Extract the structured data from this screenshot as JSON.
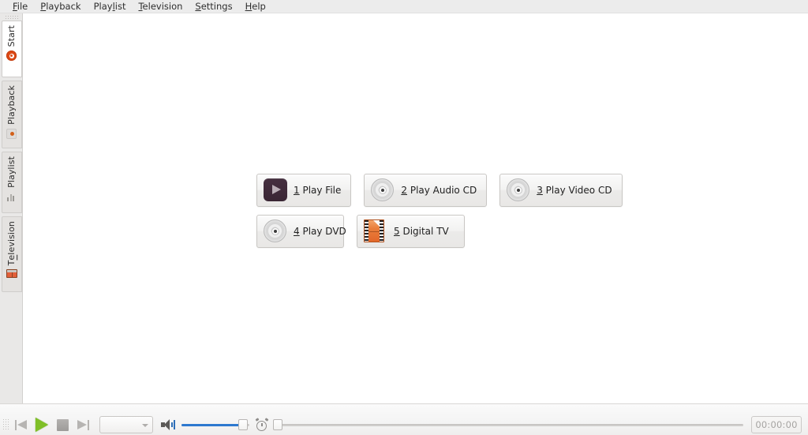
{
  "app": {
    "accent_orange": "#dd4814",
    "accent_blue": "#2d78cf",
    "play_green": "#7fbf27"
  },
  "menubar": {
    "items": [
      {
        "name": "file",
        "acc": "F",
        "rest": "ile"
      },
      {
        "name": "playback",
        "acc": "P",
        "rest": "layback"
      },
      {
        "name": "playlist",
        "pre": "Play",
        "acc": "l",
        "rest": "ist"
      },
      {
        "name": "television",
        "acc": "T",
        "rest": "elevision"
      },
      {
        "name": "settings",
        "acc": "S",
        "rest": "ettings"
      },
      {
        "name": "help",
        "acc": "H",
        "rest": "elp"
      }
    ]
  },
  "sidebar": {
    "tabs": [
      {
        "label": "Start",
        "pre": "Start",
        "acc": "",
        "rest": "",
        "icon": "ubuntu-logo-icon",
        "selected": true
      },
      {
        "label": "Playback",
        "pre": "Playback",
        "acc": "",
        "rest": "",
        "icon": "playback-dot-icon",
        "selected": false
      },
      {
        "label": "Playlist",
        "pre": "Playlist",
        "acc": "",
        "rest": "",
        "icon": "playlist-bars-icon",
        "selected": false
      },
      {
        "label": "Television",
        "pre": "T",
        "acc": "e",
        "rest": "levision",
        "icon": "tv-screen-icon",
        "selected": false
      }
    ]
  },
  "start_page": {
    "rows": [
      [
        {
          "name": "play-file",
          "num": "1",
          "label": " Play File",
          "icon": "video-file-icon"
        },
        {
          "name": "play-audio-cd",
          "num": "2",
          "label": " Play Audio CD",
          "icon": "disc-icon"
        },
        {
          "name": "play-video-cd",
          "num": "3",
          "label": " Play Video CD",
          "icon": "disc-icon"
        }
      ],
      [
        {
          "name": "play-dvd",
          "num": "4",
          "label": " Play DVD",
          "icon": "disc-icon"
        },
        {
          "name": "digital-tv",
          "num": "5",
          "label": " Digital TV",
          "icon": "filmstrip-icon"
        }
      ]
    ]
  },
  "toolbar": {
    "source_combo_value": "",
    "volume_percent": 100,
    "seek_percent": 0,
    "time_display": "00:00:00"
  }
}
